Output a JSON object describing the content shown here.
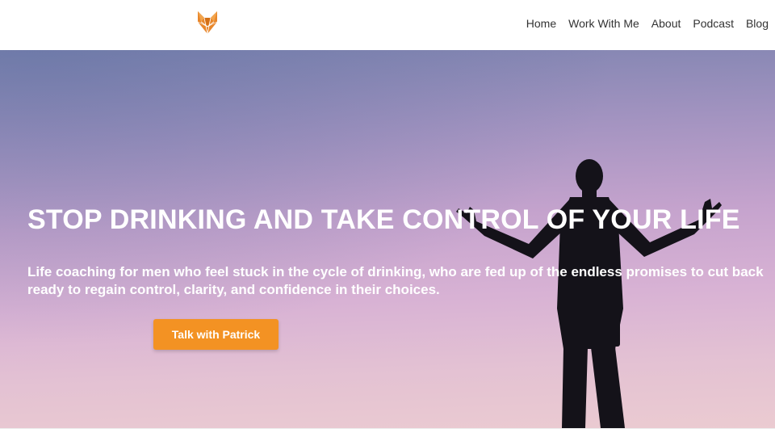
{
  "header": {
    "logo_icon": "fox-head-icon",
    "nav": [
      {
        "label": "Home"
      },
      {
        "label": "Work With Me"
      },
      {
        "label": "About"
      },
      {
        "label": "Podcast"
      },
      {
        "label": "Blog"
      }
    ]
  },
  "hero": {
    "headline": "STOP DRINKING AND TAKE CONTROL OF YOUR LIFE",
    "subtext_line1": "Life coaching for men who feel stuck in the cycle of drinking, who are fed up of the endless promises to cut back",
    "subtext_line2": "ready to regain control, clarity, and confidence in their choices.",
    "cta_label": "Talk with Patrick"
  },
  "colors": {
    "accent": "#f39223",
    "logo": "#e8862a",
    "hero_top": "#7f84b0",
    "hero_bottom": "#ebcbd1",
    "text_dark": "#333333"
  }
}
